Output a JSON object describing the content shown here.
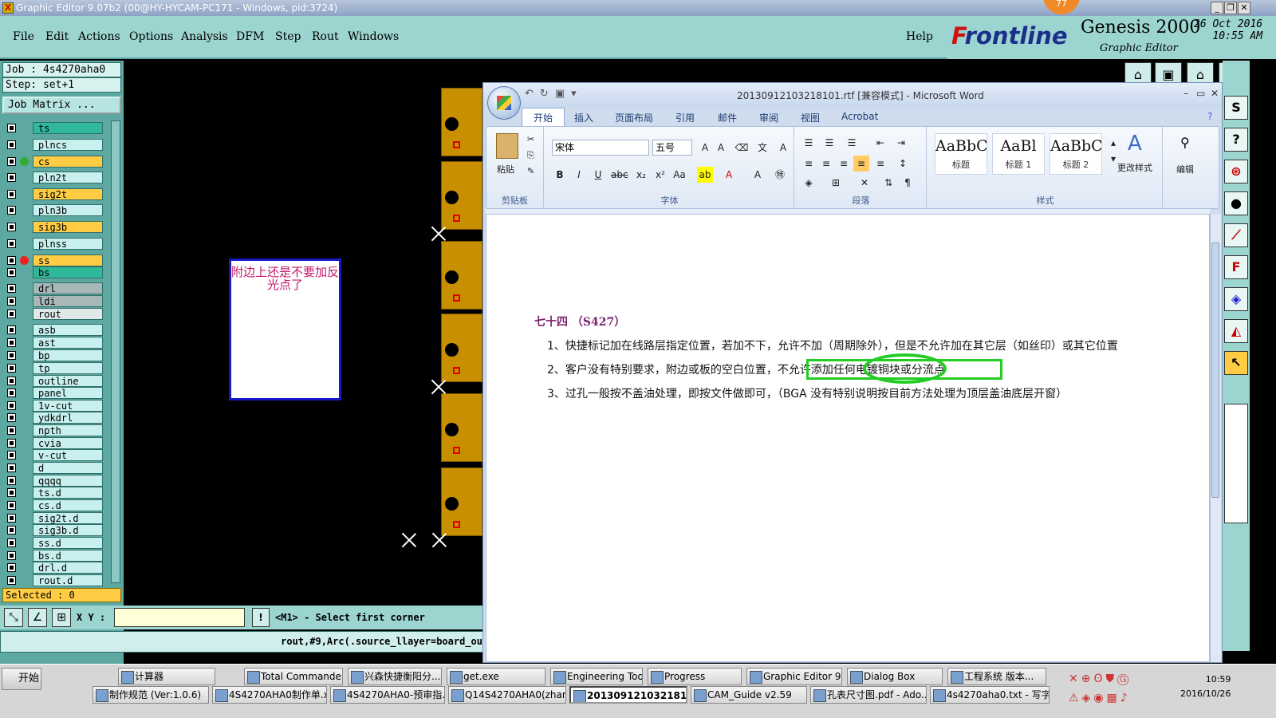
{
  "window": {
    "title": "Graphic Editor 9.07b2 (00@HY-HYCAM-PC171 - Windows, pid:3724)"
  },
  "avatar_badge": "77",
  "menu": [
    "File",
    "Edit",
    "Actions",
    "Options",
    "Analysis",
    "DFM",
    "Step",
    "Rout",
    "Windows"
  ],
  "help_label": "Help",
  "brand": {
    "logo_f": "F",
    "logo_rest": "rontline",
    "product": "Genesis 2000",
    "subtitle": "Graphic Editor",
    "date": "26 Oct 2016",
    "time": "10:55 AM"
  },
  "job": {
    "job_line": "Job : 4s4270aha0",
    "step_line": "Step: set+1",
    "job_matrix_label": "Job Matrix ..."
  },
  "layers": [
    {
      "name": "ts",
      "color": "#2fb89a"
    },
    {
      "name": "plncs",
      "color": "#c8f0ee"
    },
    {
      "name": "cs",
      "color": "#ffcc44"
    },
    {
      "name": "pln2t",
      "color": "#c8f0ee"
    },
    {
      "name": "sig2t",
      "color": "#ffcc44"
    },
    {
      "name": "pln3b",
      "color": "#c8f0ee"
    },
    {
      "name": "sig3b",
      "color": "#ffcc44"
    },
    {
      "name": "plnss",
      "color": "#c8f0ee"
    },
    {
      "name": "ss",
      "color": "#ffcc44"
    },
    {
      "name": "bs",
      "color": "#2fb89a"
    },
    {
      "name": "drl",
      "color": "#a8b8b8"
    },
    {
      "name": "ldi",
      "color": "#a8b8b8"
    },
    {
      "name": "rout",
      "color": "#e0e8e8"
    },
    {
      "name": "asb",
      "color": "#c8f0ee"
    },
    {
      "name": "ast",
      "color": "#c8f0ee"
    },
    {
      "name": "bp",
      "color": "#c8f0ee"
    },
    {
      "name": "tp",
      "color": "#c8f0ee"
    },
    {
      "name": "outline",
      "color": "#c8f0ee"
    },
    {
      "name": "panel",
      "color": "#c8f0ee"
    },
    {
      "name": "1v-cut",
      "color": "#c8f0ee"
    },
    {
      "name": "ydkdrl",
      "color": "#c8f0ee"
    },
    {
      "name": "npth",
      "color": "#c8f0ee"
    },
    {
      "name": "cvia",
      "color": "#c8f0ee"
    },
    {
      "name": "v-cut",
      "color": "#c8f0ee"
    },
    {
      "name": "d",
      "color": "#c8f0ee"
    },
    {
      "name": "qqqq",
      "color": "#c8f0ee"
    },
    {
      "name": "ts.d",
      "color": "#c8f0ee"
    },
    {
      "name": "cs.d",
      "color": "#c8f0ee"
    },
    {
      "name": "sig2t.d",
      "color": "#c8f0ee"
    },
    {
      "name": "sig3b.d",
      "color": "#c8f0ee"
    },
    {
      "name": "ss.d",
      "color": "#c8f0ee"
    },
    {
      "name": "bs.d",
      "color": "#c8f0ee"
    },
    {
      "name": "drl.d",
      "color": "#c8f0ee"
    },
    {
      "name": "rout.d",
      "color": "#c8f0ee"
    }
  ],
  "selected_label": "Selected : 0",
  "xy_label": "X Y :",
  "prompt": "<M1> - Select first corner",
  "command_line": "rout,#9,Arc(.source_llayer=board_ou",
  "note": "附边上还是不要加反光点了",
  "word": {
    "title": "20130912103218101.rtf [兼容模式] - Microsoft Word",
    "tabs": [
      "开始",
      "插入",
      "页面布局",
      "引用",
      "邮件",
      "审阅",
      "视图",
      "Acrobat"
    ],
    "paste": "粘贴",
    "clipboard": "剪贴板",
    "font_group": "字体",
    "para_group": "段落",
    "styles_group": "样式",
    "font_name": "宋体",
    "font_size": "五号",
    "styles": [
      {
        "sample": "AaBbC",
        "label": "标题"
      },
      {
        "sample": "AaBl",
        "label": "标题 1"
      },
      {
        "sample": "AaBbC",
        "label": "标题 2"
      }
    ],
    "change_styles": "更改样式",
    "edit": "编辑",
    "heading": "七十四 （S427）",
    "paras": [
      "1、快捷标记加在线路层指定位置，若加不下，允许不加（周期除外），但是不允许加在其它层（如丝印）或其它位置",
      "2、客户没有特别要求，附边或板的空白位置，不允许添加任何电镀铜块或分流点",
      "3、过孔一般按不盖油处理，即按文件做即可，（BGA 没有特别说明按目前方法处理为顶层盖油底层开窗）"
    ]
  },
  "taskbar": {
    "start": "开始",
    "row1": [
      "计算器",
      "Total Commander ...",
      "兴森快捷衡阳分...",
      "get.exe",
      "Engineering Toolki...",
      "Progress",
      "Graphic Editor 9.0...",
      "Dialog Box",
      "工程系统  版本..."
    ],
    "row2": [
      "制作规范 (Ver:1.0.6)",
      "4S4270AHA0制作单.xl...",
      "4S4270AHA0-预审指...",
      "Q14S4270AHA0(zhang...",
      "2013091210321810...",
      "CAM_Guide v2.59",
      "孔表尺寸图.pdf - Ado...",
      "4s4270aha0.txt - 写字板"
    ],
    "clock_time": "10:59",
    "clock_date": "2016/10/26"
  }
}
